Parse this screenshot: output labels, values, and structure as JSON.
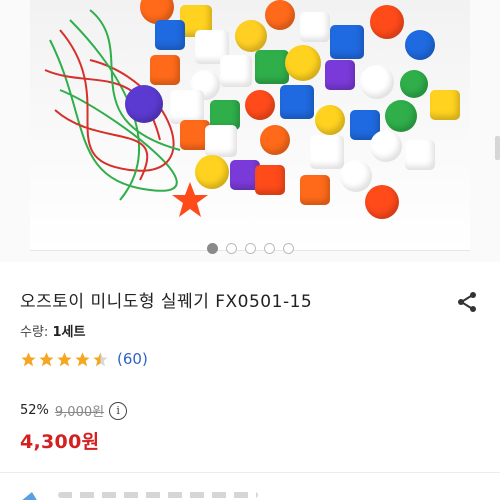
{
  "product": {
    "title": "오즈토이 미니도형 실꿰기 FX0501-15",
    "quantity_label": "수량:",
    "quantity_value": "1세트",
    "rating": 4.5,
    "review_count": "(60)",
    "discount": "52%",
    "original_price": "9,000원",
    "sale_price": "4,300원"
  },
  "gallery": {
    "total_slides": 5,
    "active_slide": 1
  },
  "icons": {
    "share": "share-icon",
    "info": "info-icon",
    "star": "star-icon"
  },
  "colors": {
    "price": "#d32020",
    "review_link": "#2f62c8",
    "star": "#f5a623"
  }
}
